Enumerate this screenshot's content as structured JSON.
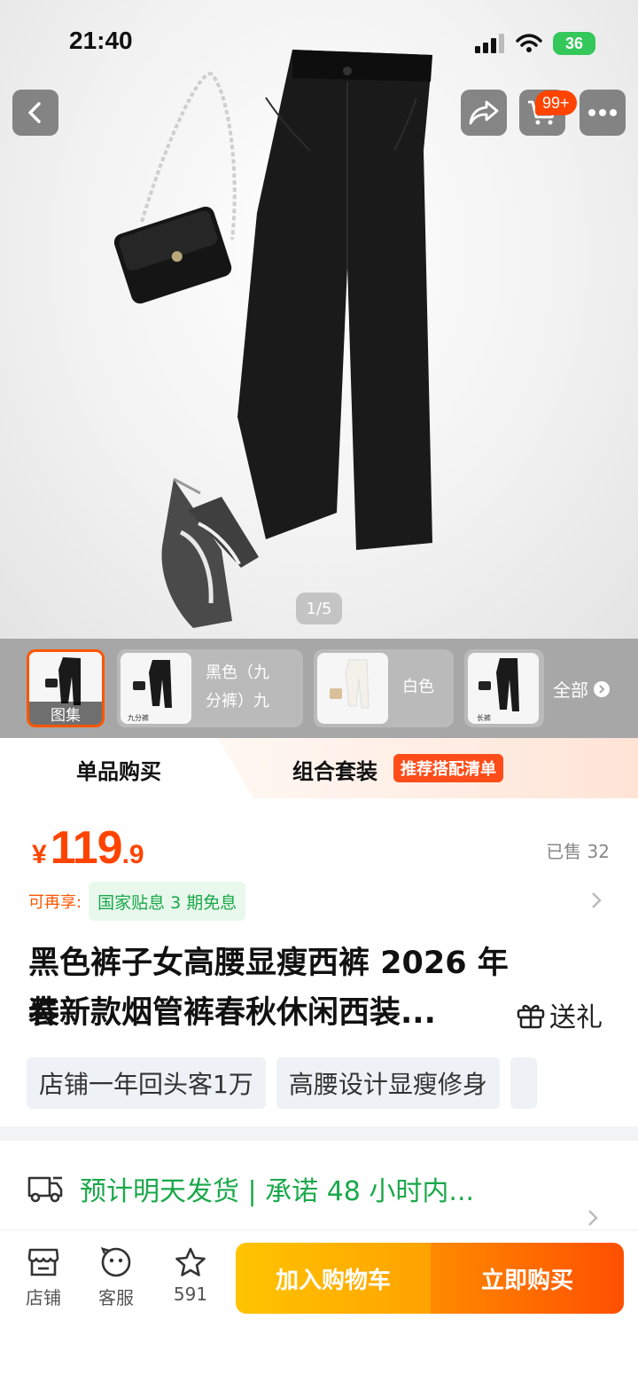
{
  "status_bar": {
    "time": "21:40",
    "battery": "36"
  },
  "header": {
    "cart_badge": "99+",
    "page_indicator": "1/5"
  },
  "sku": {
    "gallery_label": "图集",
    "items": [
      {
        "label_line1": "黑色（九",
        "label_line2": "分裤）九",
        "thumb_caption": "九分裤"
      },
      {
        "label_line1": "白色"
      },
      {
        "thumb_caption": "长裤"
      }
    ],
    "all_label": "全部"
  },
  "mode_tabs": {
    "single": "单品购买",
    "combo": "组合套装",
    "combo_badge": "推荐搭配清单"
  },
  "price": {
    "currency": "¥",
    "integer": "119",
    "decimal": ".9",
    "sold": "已售 32"
  },
  "promo": {
    "prefix": "可再享:",
    "tag": "国家贴息 3 期免息"
  },
  "product": {
    "title_line1": "黑色裤子女高腰显瘦西裤 2026 年春",
    "title_line2": "装新款烟管裤春秋休闲西装...",
    "gift_label": "送礼",
    "tags": [
      "店铺一年回头客1万",
      "高腰设计显瘦修身"
    ]
  },
  "shipping": {
    "text": "预计明天发货 | 承诺 48 小时内..."
  },
  "bottom_bar": {
    "store": "店铺",
    "service": "客服",
    "favorites": "591",
    "add_to_cart": "加入购物车",
    "buy_now": "立即购买"
  },
  "colors": {
    "accent": "#ff4400",
    "green": "#1aa84a",
    "yellow": "#ffb300"
  }
}
